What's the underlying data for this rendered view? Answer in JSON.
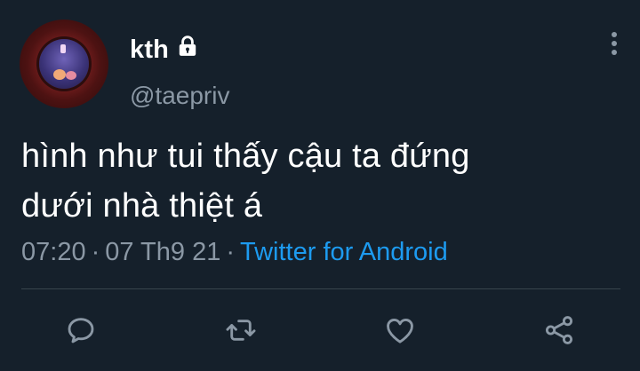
{
  "user": {
    "display_name": "kth",
    "handle": "@taepriv",
    "protected_icon": "lock-icon"
  },
  "tweet": {
    "line1": "hình như tui thấy cậu ta đứng",
    "line2": "dưới nhà thiệt á",
    "time": "07:20",
    "separator": "·",
    "date": "07 Th9 21",
    "source": "Twitter for Android"
  },
  "actions": [
    {
      "icon": "reply-icon"
    },
    {
      "icon": "retweet-icon"
    },
    {
      "icon": "like-icon"
    },
    {
      "icon": "share-icon"
    }
  ],
  "colors": {
    "background": "#15202b",
    "secondary_text": "#8b98a5",
    "link": "#1d9bf0",
    "divider": "#38444d"
  }
}
